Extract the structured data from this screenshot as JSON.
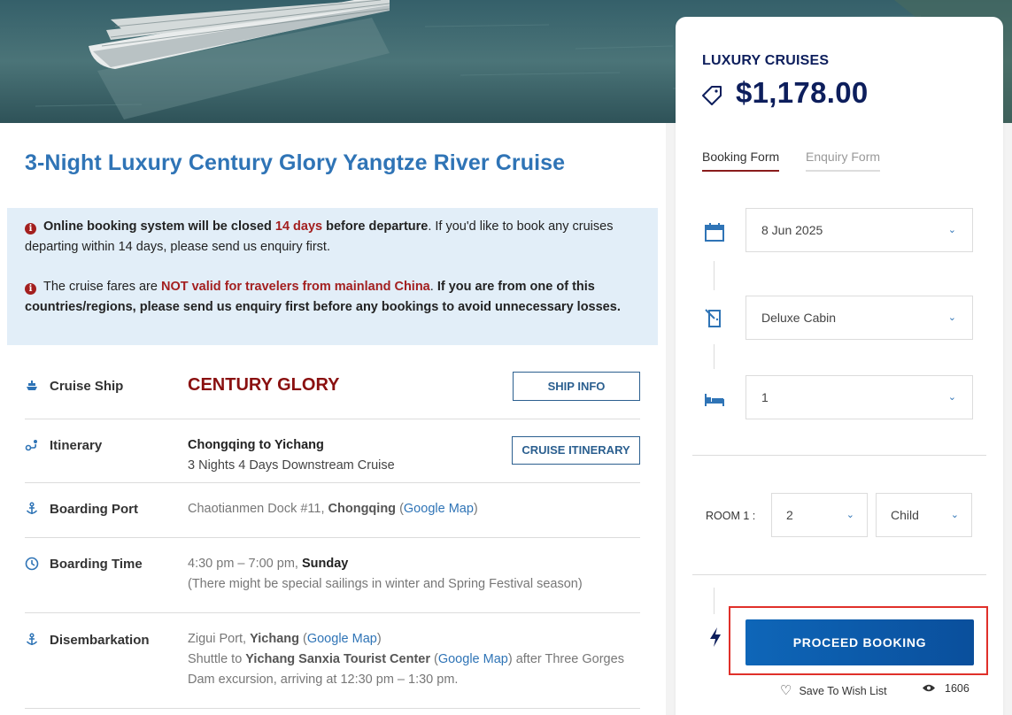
{
  "page": {
    "title": "3-Night Luxury Century Glory Yangtze River Cruise"
  },
  "notice": {
    "line1_bold_a": "Online booking system will be closed ",
    "line1_red": "14 days",
    "line1_bold_b": " before departure",
    "line1_rest": ". If you'd like to book any cruises departing within 14 days, please send us enquiry first.",
    "line2_a": "The cruise fares are ",
    "line2_red": "NOT valid for travelers from mainland China",
    "line2_b": ". ",
    "line2_bold": "If you are from one of this countries/regions, please send us enquiry first before any bookings to avoid unnecessary losses."
  },
  "details": {
    "cruise_ship": {
      "label": "Cruise Ship",
      "value": "CENTURY GLORY",
      "button": "SHIP INFO"
    },
    "itinerary": {
      "label": "Itinerary",
      "route": "Chongqing to Yichang",
      "desc": "3 Nights 4 Days Downstream Cruise",
      "button": "CRUISE ITINERARY"
    },
    "boarding_port": {
      "label": "Boarding Port",
      "value_a": "Chaotianmen Dock #11, ",
      "value_city": "Chongqing",
      "value_b": " (",
      "map_link": "Google Map",
      "value_c": ")"
    },
    "boarding_time": {
      "label": "Boarding Time",
      "time": "4:30 pm – 7:00 pm, ",
      "day": "Sunday",
      "note": "(There might be special sailings in winter and Spring Festival season)"
    },
    "disembarkation": {
      "label": "Disembarkation",
      "a1": "Zigui Port, ",
      "city1": "Yichang",
      "a2": " (",
      "map1": "Google Map",
      "a3": ")",
      "b1": "Shuttle to ",
      "center": "Yichang Sanxia Tourist Center",
      "b2": " (",
      "map2": "Google Map",
      "b3": ") after Three Gorges Dam excursion, arriving at 12:30 pm – 1:30 pm."
    }
  },
  "booking": {
    "category": "LUXURY CRUISES",
    "price": "$1,178.00",
    "tabs": [
      "Booking Form",
      "Enquiry Form"
    ],
    "date": "8 Jun 2025",
    "cabin": "Deluxe Cabin",
    "rooms": "1",
    "room_label": "ROOM 1 :",
    "guests": "2",
    "guest_type": "Child",
    "proceed": "PROCEED BOOKING",
    "wishlist": "Save To Wish List",
    "views": "1606"
  },
  "colors": {
    "title_blue": "#2f74b6",
    "navy": "#0d1e5c",
    "alert_red": "#a31f1f",
    "button_blue": "#0e66b8",
    "highlight_red": "#e0302a"
  }
}
